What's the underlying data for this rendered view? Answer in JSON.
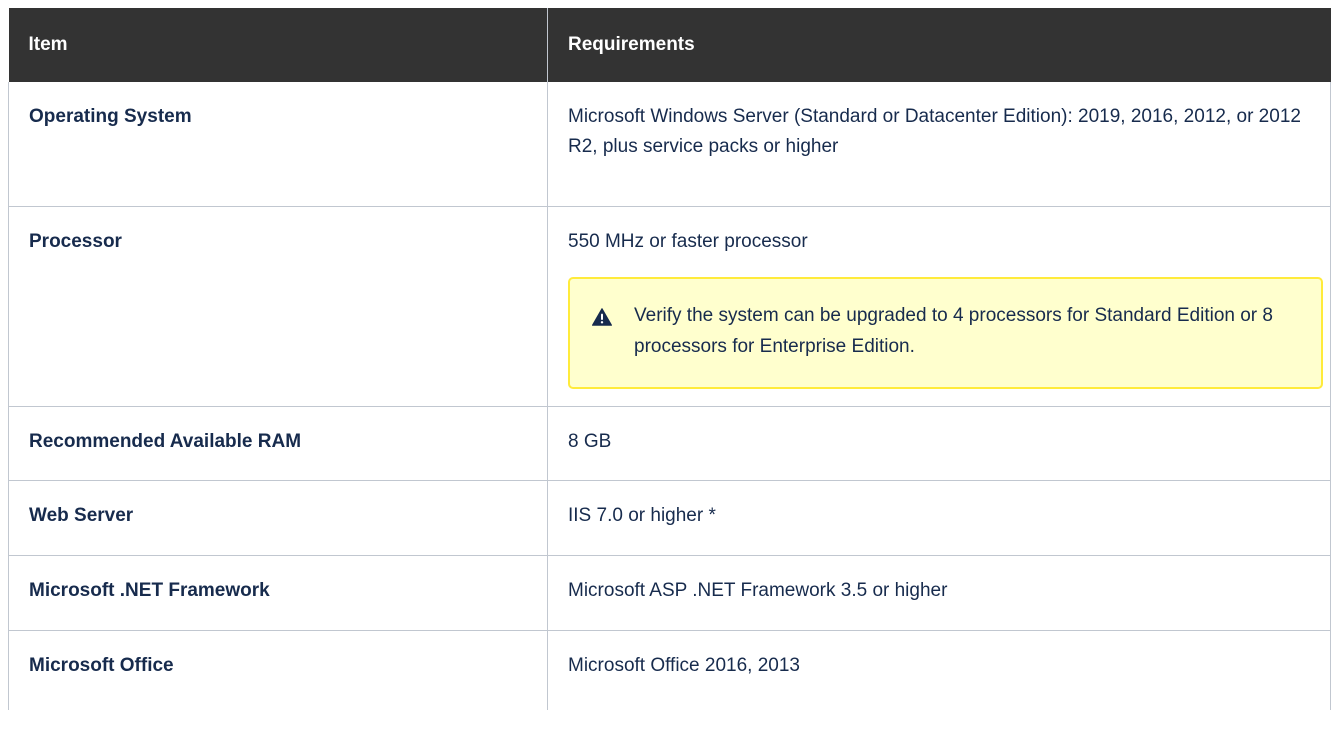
{
  "table": {
    "headers": {
      "item": "Item",
      "requirements": "Requirements"
    },
    "rows": [
      {
        "item": "Operating System",
        "requirement": "Microsoft Windows Server (Standard or Datacenter Edition): 2019, 2016, 2012, or 2012 R2, plus service packs or higher"
      },
      {
        "item": "Processor",
        "requirement": "550 MHz or faster processor",
        "note": {
          "icon": "warning-icon",
          "text": "Verify the system can be upgraded to 4 processors for Standard Edition or 8 processors for Enterprise Edition."
        }
      },
      {
        "item": "Recommended Available RAM",
        "requirement": "8 GB"
      },
      {
        "item": "Web Server",
        "requirement": "IIS 7.0 or higher *"
      },
      {
        "item": "Microsoft .NET Framework",
        "requirement": "Microsoft ASP .NET Framework 3.5 or higher"
      },
      {
        "item": "Microsoft Office",
        "requirement": "Microsoft Office 2016, 2013"
      }
    ]
  },
  "colors": {
    "header_bg": "#333333",
    "warning_bg": "#ffffce",
    "warning_border": "#ffeb3b"
  }
}
